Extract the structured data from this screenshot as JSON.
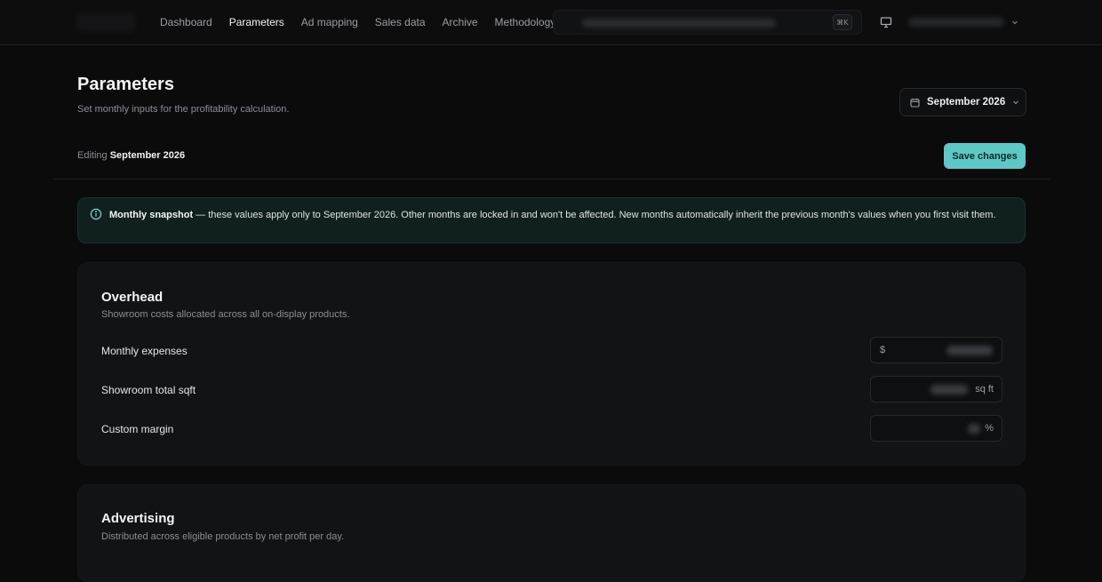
{
  "nav": {
    "items": [
      "Dashboard",
      "Parameters",
      "Ad mapping",
      "Sales data",
      "Archive",
      "Methodology"
    ],
    "active_index": 1
  },
  "search": {
    "shortcut": "⌘K"
  },
  "header": {
    "title": "Parameters",
    "subtitle": "Set monthly inputs for the profitability calculation.",
    "month_picker": "September 2026"
  },
  "editing": {
    "prefix": "Editing",
    "month": "September 2026"
  },
  "save_label": "Save changes",
  "notice": {
    "bold": "Monthly snapshot",
    "text": " — these values apply only to September 2026. Other months are locked in and won't be affected. New months automatically inherit the previous month's values when you first visit them."
  },
  "overhead": {
    "title": "Overhead",
    "description": "Showroom costs allocated across all on-display products.",
    "rows": [
      {
        "label": "Monthly expenses",
        "prefix": "$",
        "suffix": ""
      },
      {
        "label": "Showroom total sqft",
        "prefix": "",
        "suffix": "sq ft"
      },
      {
        "label": "Custom margin",
        "prefix": "",
        "suffix": "%"
      }
    ]
  },
  "advertising": {
    "title": "Advertising",
    "description": "Distributed across eligible products by net profit per day."
  },
  "colors": {
    "accent": "#5ec8c4",
    "background": "#0b0b0c",
    "card": "#121314",
    "notice_bg": "#10201f"
  },
  "icons": [
    "monitor-icon",
    "chevron-down-icon",
    "calendar-icon",
    "info-icon"
  ]
}
